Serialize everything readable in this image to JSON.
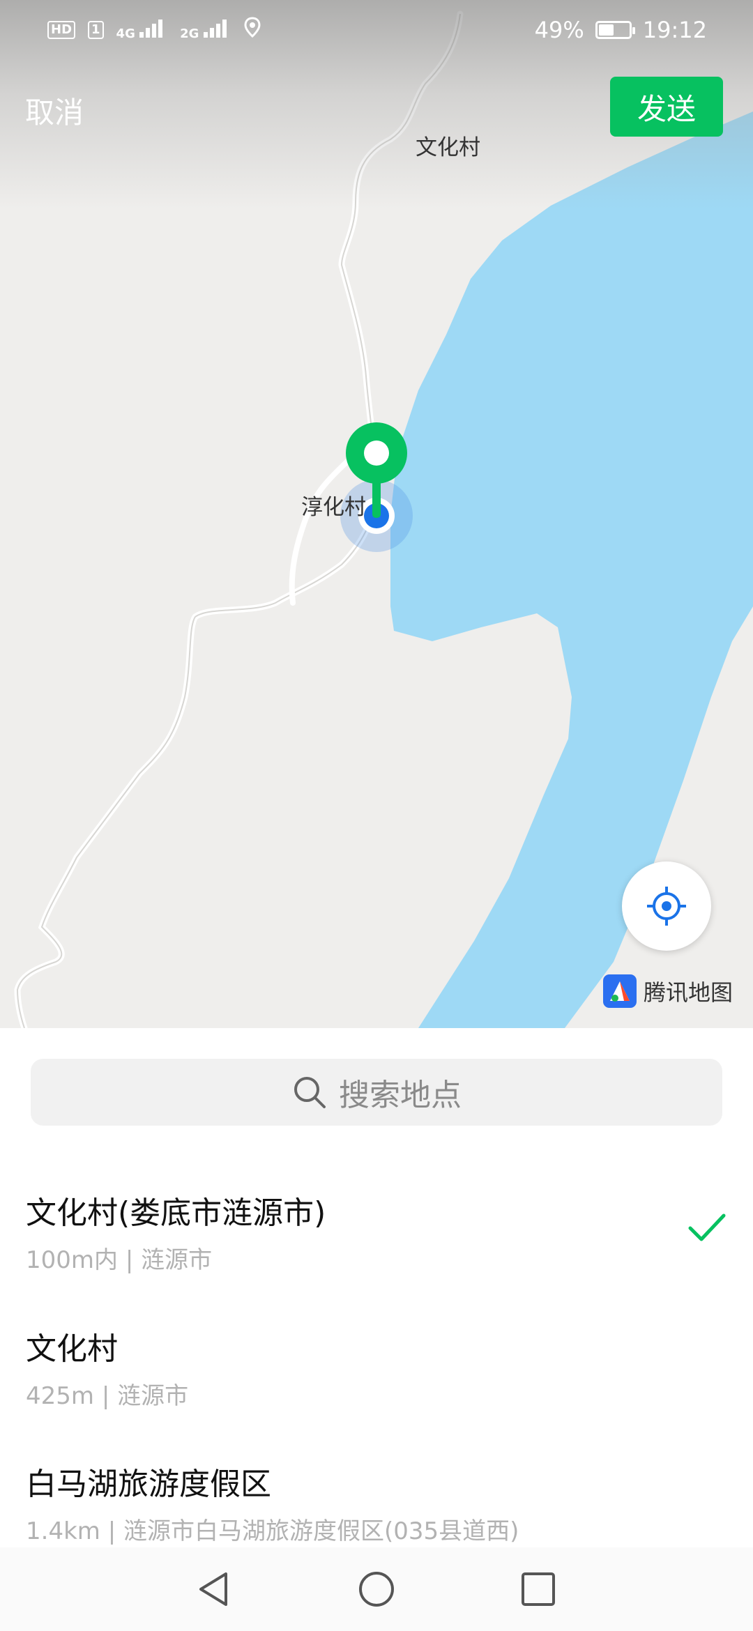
{
  "status_bar": {
    "hd_badge": "HD",
    "sim1_badge": "1",
    "network1": "4G",
    "network2": "2G",
    "battery_percent": "49%",
    "battery_level": 0.49,
    "time": "19:12"
  },
  "header": {
    "cancel_label": "取消",
    "send_label": "发送",
    "send_color": "#07c160"
  },
  "map": {
    "labels": {
      "village_north": "文化村",
      "village_center": "淳化村"
    },
    "water_color": "#9ed9f5",
    "pin_color": "#07c160",
    "locate_icon": "crosshair-icon",
    "provider": "腾讯地图"
  },
  "search": {
    "icon": "search-icon",
    "placeholder": "搜索地点"
  },
  "results": [
    {
      "name": "文化村(娄底市涟源市)",
      "detail": "100m内 | 涟源市",
      "selected": true
    },
    {
      "name": "文化村",
      "detail": "425m | 涟源市",
      "selected": false
    },
    {
      "name": "白马湖旅游度假区",
      "detail": "1.4km | 涟源市白马湖旅游度假区(035县道西)",
      "selected": false
    }
  ],
  "nav_bar": {
    "back_icon": "back-triangle-icon",
    "home_icon": "home-circle-icon",
    "recents_icon": "recents-square-icon"
  }
}
